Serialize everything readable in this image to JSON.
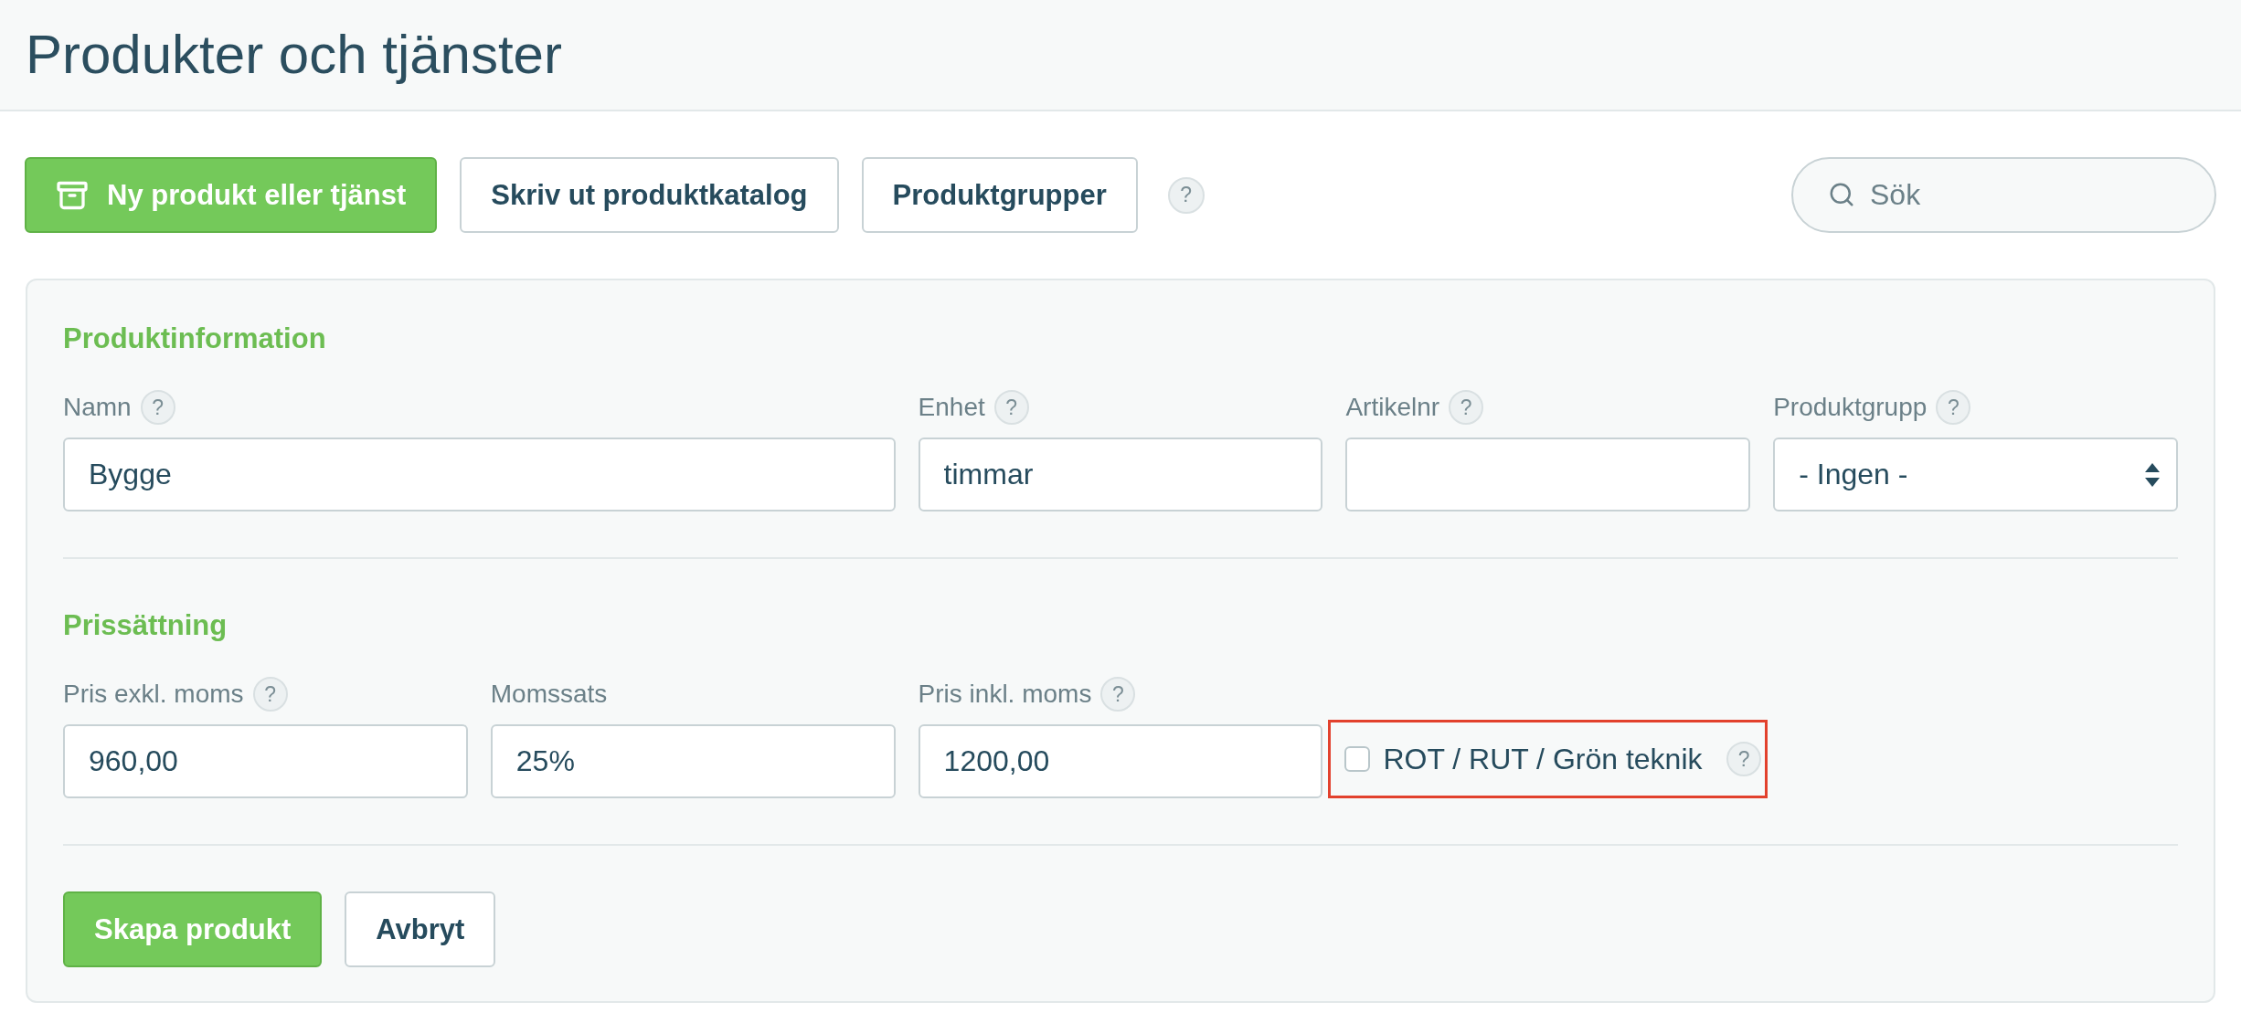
{
  "header": {
    "title": "Produkter och tjänster"
  },
  "toolbar": {
    "buttons": [
      {
        "label": "Ny produkt eller tjänst",
        "kind": "primary"
      },
      {
        "label": "Skriv ut produktkatalog",
        "kind": "secondary"
      },
      {
        "label": "Produktgrupper",
        "kind": "secondary"
      }
    ],
    "help": "?",
    "search": {
      "placeholder": "Sök"
    }
  },
  "form": {
    "sections": [
      {
        "title": "Produktinformation",
        "fields": [
          {
            "kind": "text",
            "label": "Namn",
            "help": "?",
            "value": "Bygge"
          },
          {
            "kind": "text",
            "label": "Enhet",
            "help": "?",
            "value": "timmar"
          },
          {
            "kind": "text",
            "label": "Artikelnr",
            "help": "?"
          },
          {
            "kind": "select",
            "label": "Produktgrupp",
            "help": "?",
            "value": "- Ingen -"
          }
        ]
      },
      {
        "title": "Prissättning",
        "fields": [
          {
            "kind": "text",
            "label": "Pris exkl. moms",
            "help": "?",
            "value": "960,00"
          },
          {
            "kind": "text",
            "label": "Momssats",
            "value": "25%"
          },
          {
            "kind": "text",
            "label": "Pris inkl. moms",
            "help": "?",
            "value": "1200,00"
          },
          {
            "kind": "checkbox",
            "label": "ROT / RUT / Grön teknik",
            "help": "?",
            "checked": false,
            "highlighted": true
          }
        ]
      }
    ],
    "actions": [
      {
        "label": "Skapa produkt",
        "kind": "primary"
      },
      {
        "label": "Avbryt",
        "kind": "secondary"
      }
    ]
  }
}
